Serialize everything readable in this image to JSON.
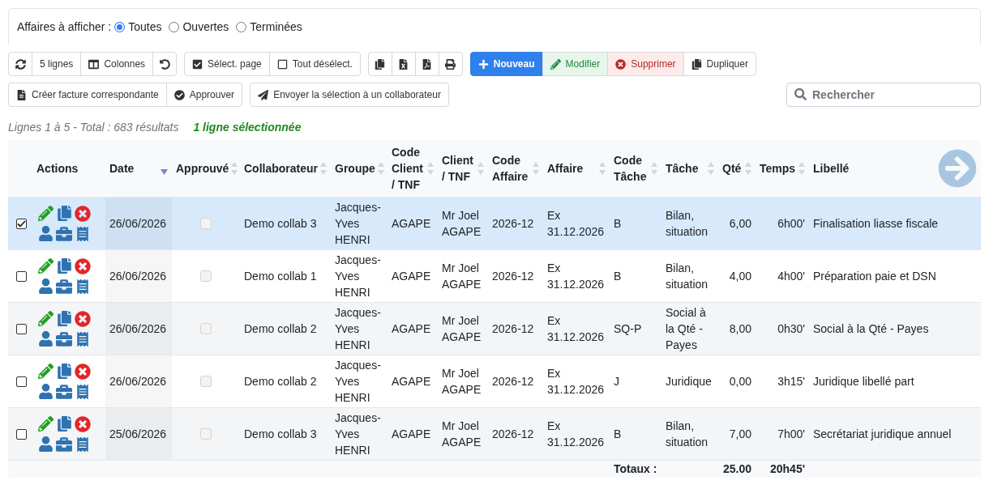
{
  "filter": {
    "label": "Affaires à afficher :",
    "options": [
      {
        "label": "Toutes",
        "selected": true
      },
      {
        "label": "Ouvertes",
        "selected": false
      },
      {
        "label": "Terminées",
        "selected": false
      }
    ]
  },
  "toolbar_rows": [
    {
      "groups": [
        {
          "buttons": [
            {
              "kind": "icon"
            },
            {
              "kind": "plain",
              "label": "5 lignes"
            },
            {
              "kind": "plain",
              "label": "Colonnes"
            },
            {
              "kind": "icon"
            }
          ]
        },
        {
          "buttons": [
            {
              "kind": "plain",
              "label": "Sélect. page"
            },
            {
              "kind": "plain",
              "label": "Tout désélect."
            }
          ]
        },
        {
          "buttons": [
            {
              "kind": "icon"
            },
            {
              "kind": "icon"
            },
            {
              "kind": "icon"
            },
            {
              "kind": "icon"
            }
          ]
        },
        {
          "buttons": [
            {
              "kind": "primary",
              "label": "Nouveau"
            },
            {
              "kind": "success",
              "label": "Modifier"
            },
            {
              "kind": "danger",
              "label": "Supprimer"
            },
            {
              "kind": "plain",
              "label": "Dupliquer"
            }
          ]
        }
      ]
    },
    {
      "groups": [
        {
          "buttons": [
            {
              "kind": "plain",
              "label": "Créer facture correspondante"
            },
            {
              "kind": "plain",
              "label": "Approuver"
            }
          ]
        },
        {
          "buttons": [
            {
              "kind": "plain",
              "label": "Envoyer la sélection à un collaborateur"
            }
          ]
        }
      ]
    }
  ],
  "search": {
    "placeholder": "Rechercher"
  },
  "status": {
    "count": "Lignes 1 à 5 - Total : 683 résultats",
    "selection": "1 ligne sélectionnée"
  },
  "table": {
    "columns": [
      {
        "label": "Actions",
        "sortable": false,
        "sorted": false
      },
      {
        "label": "Date",
        "sortable": true,
        "sorted": true
      },
      {
        "label": "Approuvé",
        "sortable": true,
        "sorted": false
      },
      {
        "label": "Collaborateur",
        "sortable": true,
        "sorted": false
      },
      {
        "label": "Groupe",
        "sortable": true,
        "sorted": false
      },
      {
        "label": "Code Client / TNF",
        "sortable": true,
        "sorted": false
      },
      {
        "label": "Client / TNF",
        "sortable": true,
        "sorted": false
      },
      {
        "label": "Code Affaire",
        "sortable": true,
        "sorted": false
      },
      {
        "label": "Affaire",
        "sortable": true,
        "sorted": false
      },
      {
        "label": "Code Tâche",
        "sortable": true,
        "sorted": false
      },
      {
        "label": "Tâche",
        "sortable": true,
        "sorted": false
      },
      {
        "label": "Qté",
        "sortable": true,
        "sorted": false
      },
      {
        "label": "Temps",
        "sortable": true,
        "sorted": false
      },
      {
        "label": "Libellé",
        "sortable": false,
        "sorted": false
      }
    ],
    "rows": [
      {
        "selected": true,
        "date": "26/06/2026",
        "approved": {
          "checked": false,
          "disabled": true
        },
        "collaborateur": "Demo collab 3",
        "groupe": "Jacques-Yves HENRI",
        "code_client": "AGAPE",
        "client": "Mr Joel AGAPE",
        "code_affaire": "2026-12",
        "affaire": "Ex 31.12.2026",
        "code_tache": "B",
        "tache": "Bilan, situation",
        "qte": "6,00",
        "temps": "6h00'",
        "libelle": "Finalisation liasse fiscale"
      },
      {
        "selected": false,
        "date": "26/06/2026",
        "approved": {
          "checked": false,
          "disabled": true
        },
        "collaborateur": "Demo collab 1",
        "groupe": "Jacques-Yves HENRI",
        "code_client": "AGAPE",
        "client": "Mr Joel AGAPE",
        "code_affaire": "2026-12",
        "affaire": "Ex 31.12.2026",
        "code_tache": "B",
        "tache": "Bilan, situation",
        "qte": "4,00",
        "temps": "4h00'",
        "libelle": "Préparation paie et DSN"
      },
      {
        "selected": false,
        "date": "26/06/2026",
        "approved": {
          "checked": false,
          "disabled": true
        },
        "collaborateur": "Demo collab 2",
        "groupe": "Jacques-Yves HENRI",
        "code_client": "AGAPE",
        "client": "Mr Joel AGAPE",
        "code_affaire": "2026-12",
        "affaire": "Ex 31.12.2026",
        "code_tache": "SQ-P",
        "tache": "Social à la Qté - Payes",
        "qte": "8,00",
        "temps": "0h30'",
        "libelle": "Social à la Qté - Payes"
      },
      {
        "selected": false,
        "date": "26/06/2026",
        "approved": {
          "checked": false,
          "disabled": true
        },
        "collaborateur": "Demo collab 2",
        "groupe": "Jacques-Yves HENRI",
        "code_client": "AGAPE",
        "client": "Mr Joel AGAPE",
        "code_affaire": "2026-12",
        "affaire": "Ex 31.12.2026",
        "code_tache": "J",
        "tache": "Juridique",
        "qte": "0,00",
        "temps": "3h15'",
        "libelle": "Juridique libellé part"
      },
      {
        "selected": false,
        "date": "25/06/2026",
        "approved": {
          "checked": false,
          "disabled": true
        },
        "collaborateur": "Demo collab 3",
        "groupe": "Jacques-Yves HENRI",
        "code_client": "AGAPE",
        "client": "Mr Joel AGAPE",
        "code_affaire": "2026-12",
        "affaire": "Ex 31.12.2026",
        "code_tache": "B",
        "tache": "Bilan, situation",
        "qte": "7,00",
        "temps": "7h00'",
        "libelle": "Secrétariat juridique annuel"
      }
    ],
    "totals": {
      "label": "Totaux :",
      "qte": "25.00",
      "temps": "20h45'"
    }
  }
}
